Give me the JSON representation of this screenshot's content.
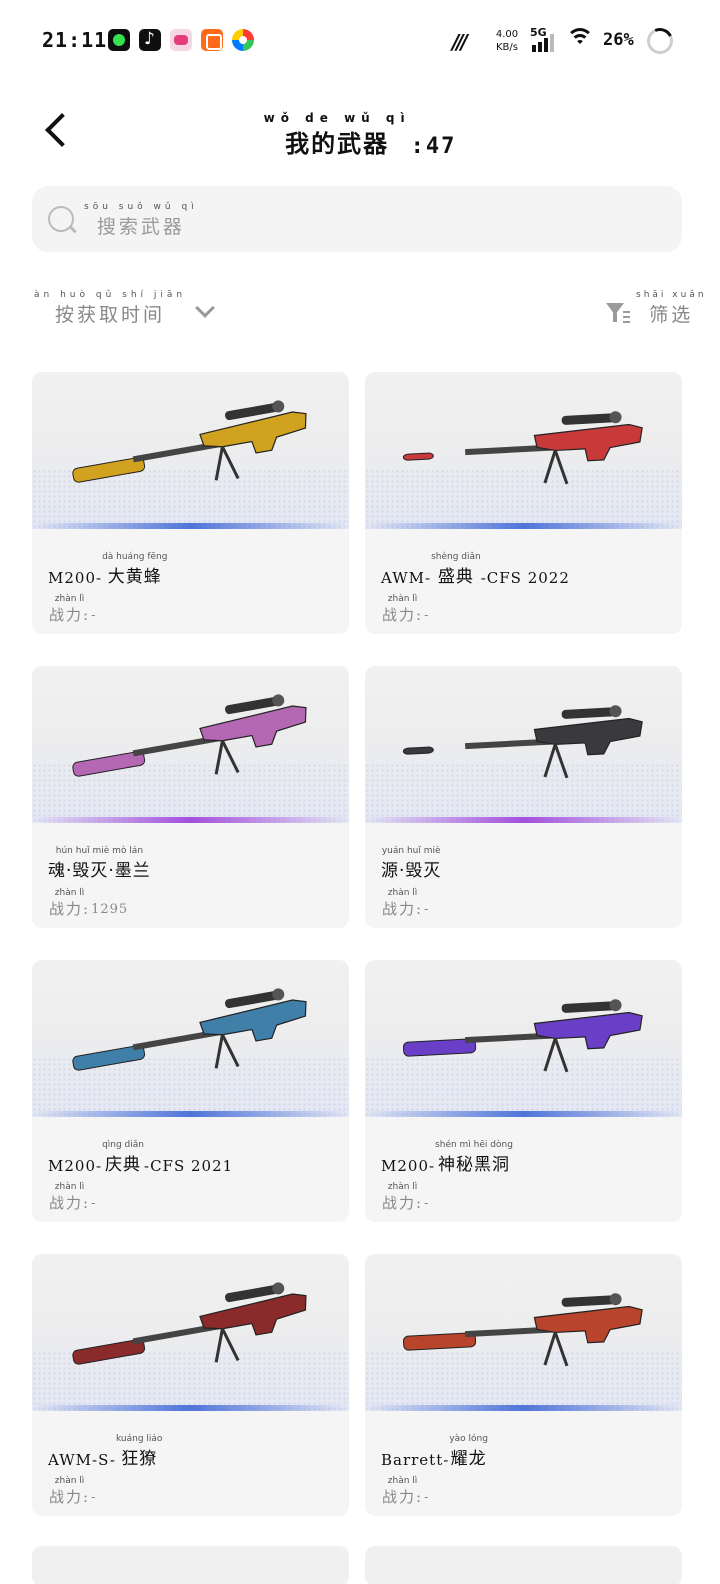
{
  "status_bar": {
    "time": "21:11",
    "apps": [
      "game-app-icon",
      "tiktok-icon",
      "pink-app-icon",
      "kuaishou-icon",
      "colorful-app-icon"
    ],
    "net_speed_value": "4.00",
    "net_speed_unit": "KB/s",
    "network": "5G",
    "battery": "26%"
  },
  "header": {
    "title_cn": "我的武器",
    "title_pinyin": "wǒ de wǔ qì",
    "title_count": ":47"
  },
  "search": {
    "placeholder": "搜索武器",
    "placeholder_pinyin": "sōu suǒ wǔ qì"
  },
  "sort": {
    "label": "按获取时间",
    "label_pinyin": "àn huò qǔ shí jiān"
  },
  "filter": {
    "label": "筛选",
    "label_pinyin": "shāi xuǎn"
  },
  "power_label": "战力:",
  "power_label_pinyin": "zhàn lì",
  "weapons": [
    {
      "prefix": "M200-",
      "name_cn": "大黄蜂",
      "pinyin": "dà huáng fēng",
      "suffix": "",
      "power": "-",
      "rarity_color": "#4f74d9",
      "gun_color": "#d1a21f"
    },
    {
      "prefix": "AWM-",
      "name_cn": "盛典",
      "pinyin": "shèng diǎn",
      "suffix": "-CFS 2022",
      "power": "-",
      "rarity_color": "#4f74d9",
      "gun_color": "#c8393a"
    },
    {
      "prefix": "",
      "name_cn": "魂·毁灭·墨兰",
      "pinyin": "hún huǐ miè mò lán",
      "suffix": "",
      "power": "1295",
      "rarity_color": "#a34fdc",
      "gun_color": "#b468b4"
    },
    {
      "prefix": "",
      "name_cn": "源·毁灭",
      "pinyin": "yuán huǐ miè",
      "suffix": "",
      "power": "-",
      "rarity_color": "#a34fdc",
      "gun_color": "#3a3a3e"
    },
    {
      "prefix": "M200-",
      "name_cn": "庆典",
      "pinyin": "qìng diǎn",
      "suffix": "-CFS 2021",
      "power": "-",
      "rarity_color": "#4f74d9",
      "gun_color": "#3f7fa8"
    },
    {
      "prefix": "M200-",
      "name_cn": "神秘黑洞",
      "pinyin": "shén mì hēi dòng",
      "suffix": "",
      "power": "-",
      "rarity_color": "#4f74d9",
      "gun_color": "#6a3fc8"
    },
    {
      "prefix": "AWM-S-",
      "name_cn": "狂獠",
      "pinyin": "kuáng liáo",
      "suffix": "",
      "power": "-",
      "rarity_color": "#4f74d9",
      "gun_color": "#8a2a2a"
    },
    {
      "prefix": "Barrett-",
      "name_cn": "耀龙",
      "pinyin": "yào lóng",
      "suffix": "",
      "power": "-",
      "rarity_color": "#4f74d9",
      "gun_color": "#b8442c"
    }
  ]
}
